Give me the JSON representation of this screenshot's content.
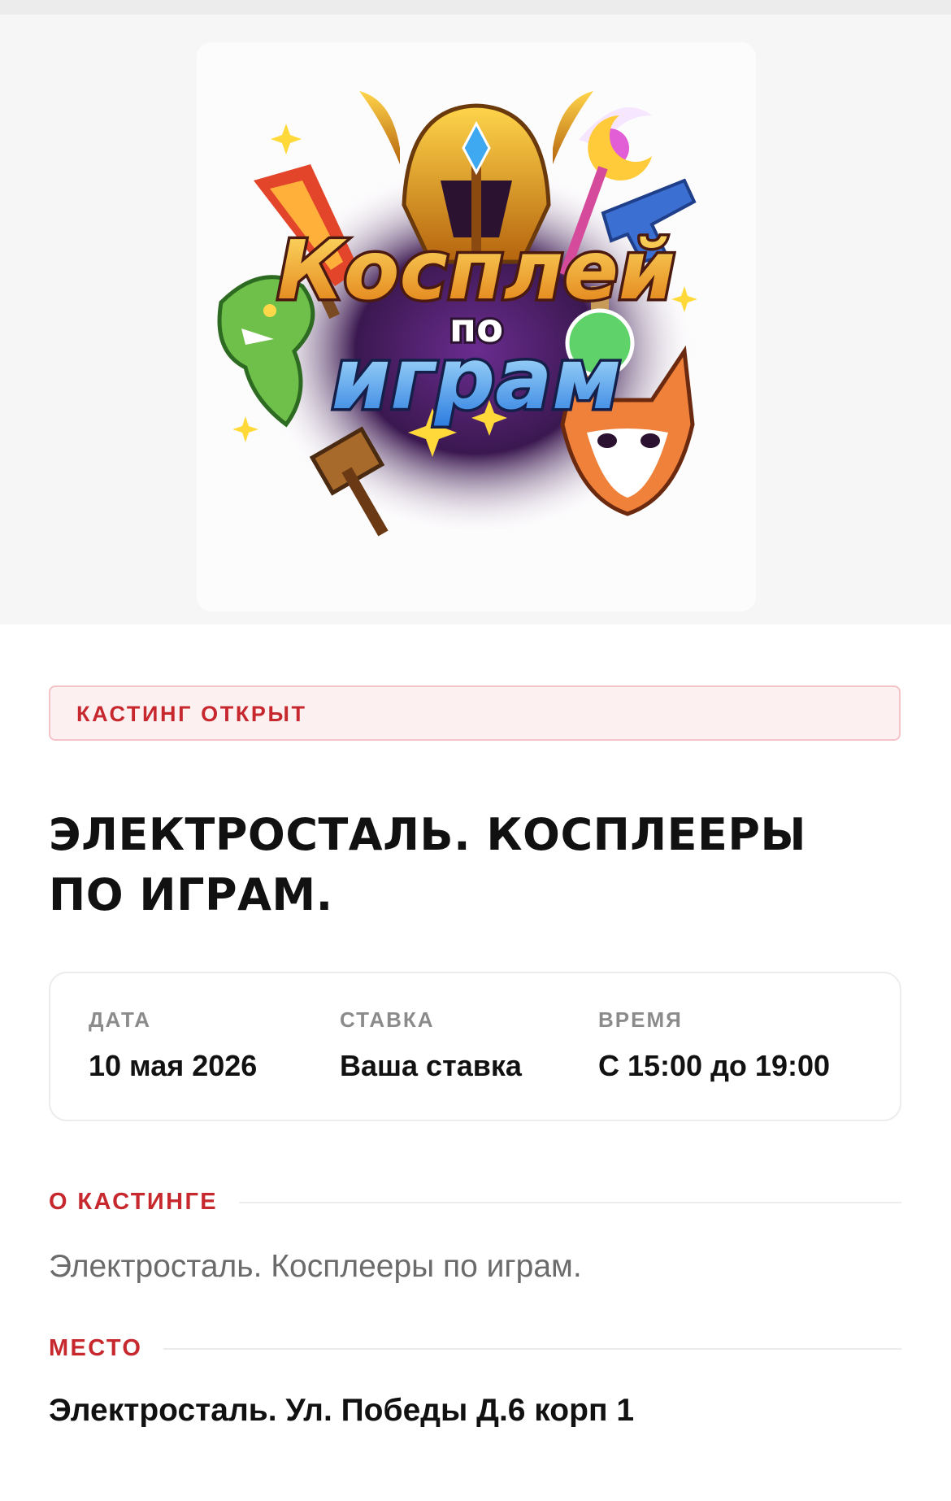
{
  "hero": {
    "poster_title_line1": "Косплей",
    "poster_title_line2": "по",
    "poster_title_line3": "играм"
  },
  "status_badge": {
    "label": "КАСТИНГ ОТКРЫТ"
  },
  "title": {
    "line1": "ЭЛЕКТРОСТАЛЬ. КОСПЛЕЕРЫ",
    "line2": "ПО ИГРАМ."
  },
  "info": {
    "date_label": "ДАТА",
    "date_value": "10 мая 2026",
    "rate_label": "СТАВКА",
    "rate_value": "Ваша ставка",
    "time_label": "ВРЕМЯ",
    "time_value": "С 15:00 до 19:00"
  },
  "about": {
    "heading": "О КАСТИНГЕ",
    "text": "Электросталь. Косплееры по играм."
  },
  "place": {
    "heading": "МЕСТО",
    "text": "Электросталь. Ул. Победы Д.6 корп 1"
  },
  "colors": {
    "accent": "#c6282e",
    "badge_bg": "#fdf0f1",
    "muted": "#8b8b8b"
  }
}
